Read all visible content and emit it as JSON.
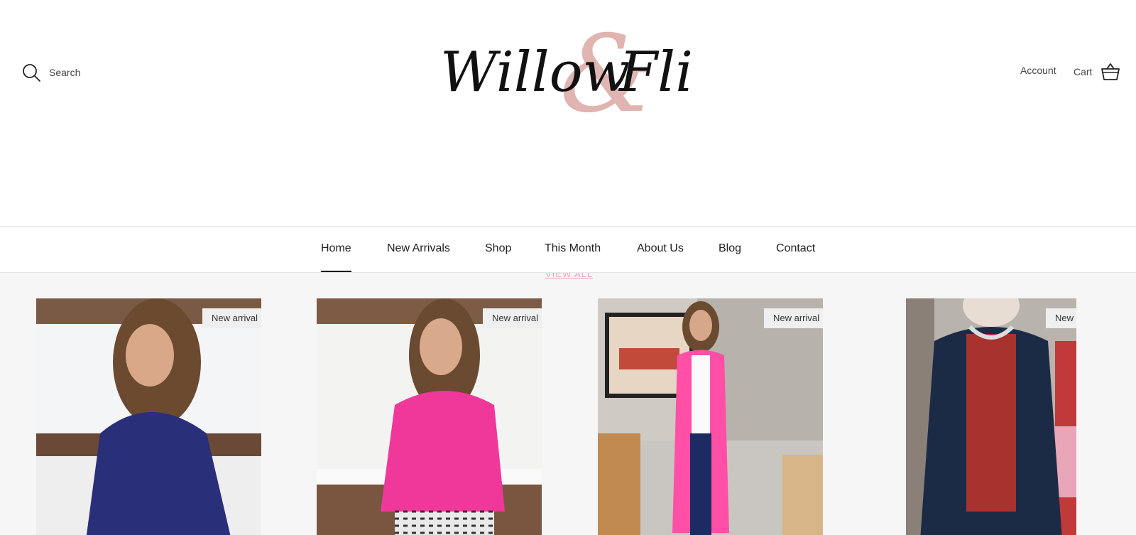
{
  "header": {
    "search_label": "Search",
    "logo": {
      "word_left": "Willow",
      "ampersand": "&",
      "word_right": "Fli"
    },
    "account_label": "Account",
    "cart_label": "Cart"
  },
  "nav": {
    "items": [
      {
        "label": "Home",
        "active": true
      },
      {
        "label": "New Arrivals"
      },
      {
        "label": "Shop"
      },
      {
        "label": "This Month"
      },
      {
        "label": "About Us"
      },
      {
        "label": "Blog"
      },
      {
        "label": "Contact"
      }
    ]
  },
  "collection": {
    "view_all_label": "VIEW ALL",
    "products": [
      {
        "badge": "New arrival",
        "garment_color": "#2a2f7a"
      },
      {
        "badge": "New arrival",
        "garment_color": "#f0389a"
      },
      {
        "badge": "New arrival",
        "garment_color": "#ff4fa6"
      },
      {
        "badge": "New arrival",
        "garment_color": "#1c2b45"
      }
    ]
  },
  "colors": {
    "logo_text": "#111111",
    "logo_ampersand": "#e0b4b0",
    "accent_pink": "#f2a6c2",
    "page_background": "#f6f6f6"
  }
}
